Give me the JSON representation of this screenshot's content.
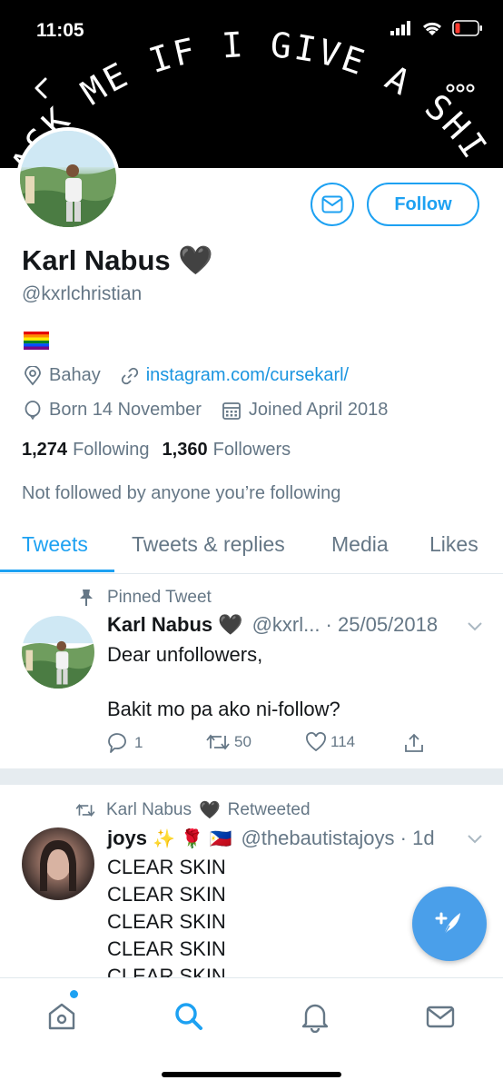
{
  "status_bar": {
    "time": "11:05"
  },
  "header": {
    "banner_text": "ASK ME IF I GIVE A SHIT",
    "back_icon": "chevron-left-icon",
    "more_icon": "more-dots-icon"
  },
  "profile": {
    "name": "Karl Nabus",
    "name_emoji": "🖤",
    "handle": "@kxrlchristian",
    "bio_emoji": "rainbow-flag",
    "location": "Bahay",
    "website": "instagram.com/cursekarl/",
    "born": "Born 14 November",
    "joined": "Joined April 2018",
    "following_count": "1,274",
    "following_label": "Following",
    "followers_count": "1,360",
    "followers_label": "Followers",
    "not_followed": "Not followed by anyone you’re following",
    "follow_label": "Follow"
  },
  "tabs": [
    {
      "label": "Tweets",
      "active": true
    },
    {
      "label": "Tweets & replies",
      "active": false
    },
    {
      "label": "Media",
      "active": false
    },
    {
      "label": "Likes",
      "active": false
    }
  ],
  "tweets": [
    {
      "context": "Pinned Tweet",
      "name": "Karl Nabus",
      "name_emoji": "🖤",
      "handle_date": "@kxrl... · 25/05/2018",
      "body_line1": "Dear unfollowers,",
      "body_line2": "Bakit mo pa ako ni-follow?",
      "replies": "1",
      "retweets": "50",
      "likes": "114"
    },
    {
      "context_name": "Karl Nabus",
      "context_emoji": "🖤",
      "context_suffix": "Retweeted",
      "name": "joys",
      "name_emoji": "✨ 🌹 🇵🇭",
      "handle_date": "@thebautistajoys · 1d",
      "lines": [
        "CLEAR SKIN",
        "CLEAR SKIN",
        "CLEAR SKIN",
        "CLEAR SKIN",
        "CLEAR SKIN"
      ]
    }
  ],
  "colors": {
    "accent": "#1da1f2",
    "secondary_text": "#657786",
    "primary_text": "#14171a",
    "fab": "#4a9fea"
  },
  "bottom_nav": [
    "home-icon",
    "search-icon",
    "bell-icon",
    "mail-icon"
  ]
}
